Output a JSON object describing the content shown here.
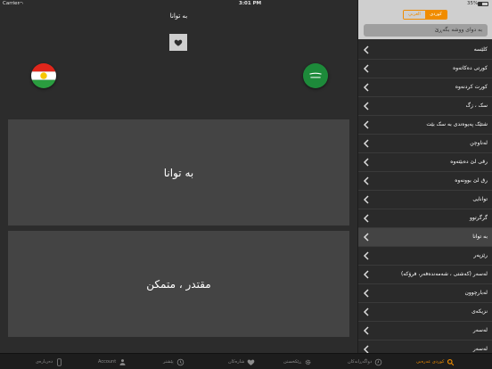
{
  "status_bar": {
    "carrier": "Carrier",
    "time": "3:01 PM",
    "battery": "35%"
  },
  "main": {
    "title": "بە توانا",
    "source_text": "بە توانا",
    "target_text": "مقتدر ، متمكن"
  },
  "sidebar": {
    "segments": {
      "kurdi": "کوردی",
      "arabic": "العربي"
    },
    "search_placeholder": "بە دوای ووشە بگەڕێ",
    "items": [
      {
        "label": "کلێسە",
        "selected": false
      },
      {
        "label": "کورتی دەکاتەوە",
        "selected": false
      },
      {
        "label": "کورت کردنەوە",
        "selected": false
      },
      {
        "label": "سک ، زگ",
        "selected": false
      },
      {
        "label": "شتێک پەیوەندی بە سک بێت",
        "selected": false
      },
      {
        "label": "لەناوچن",
        "selected": false
      },
      {
        "label": "رقی لێ دەبێتەوە",
        "selected": false
      },
      {
        "label": "رق لێ بوونەوە",
        "selected": false
      },
      {
        "label": "توانایی",
        "selected": false
      },
      {
        "label": "گرگرتوو",
        "selected": false
      },
      {
        "label": "بە توانا",
        "selected": true
      },
      {
        "label": "رێزپەر",
        "selected": false
      },
      {
        "label": "لەسەر (کەشتی ، شەمەندەفەر، فرۆکە)",
        "selected": false
      },
      {
        "label": "لەبارچوون",
        "selected": false
      },
      {
        "label": "نزیکەی",
        "selected": false
      },
      {
        "label": "لەسەر",
        "selected": false
      },
      {
        "label": "لەسەر",
        "selected": false
      }
    ]
  },
  "tabbar": {
    "tabs": [
      {
        "label": "دەربارەی",
        "icon": "phone-icon"
      },
      {
        "label": "Account",
        "icon": "person-icon"
      },
      {
        "label": "پێشتر",
        "icon": "clock-icon"
      },
      {
        "label": "شارەکان",
        "icon": "heart-icon"
      },
      {
        "label": "ڕێکخستن",
        "icon": "gear-icon"
      },
      {
        "label": "دواگەڕانەکان",
        "icon": "history-icon"
      },
      {
        "label": "کوردی عەرەبی",
        "icon": "search-icon"
      }
    ]
  },
  "colors": {
    "accent": "#f08c00",
    "background": "#2c2c2c",
    "card": "#444444"
  }
}
